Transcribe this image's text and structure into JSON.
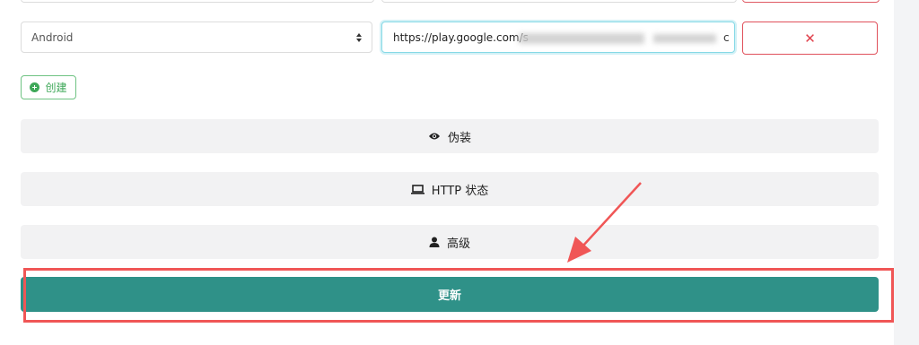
{
  "row": {
    "platform_select": {
      "value": "Android"
    },
    "url_input": {
      "value": "https://play.google.com/s",
      "tail": "c"
    },
    "delete_button": {
      "label": "✕"
    }
  },
  "create_button": {
    "label": "创建"
  },
  "sections": [
    {
      "label": "伪装",
      "icon": "eye-icon"
    },
    {
      "label": "HTTP 状态",
      "icon": "monitor-icon"
    },
    {
      "label": "高级",
      "icon": "user-icon"
    }
  ],
  "update_button": {
    "label": "更新"
  },
  "colors": {
    "primary": "#2f9188",
    "danger": "#e0505b",
    "success": "#3ea858",
    "annotation": "#f05656"
  }
}
